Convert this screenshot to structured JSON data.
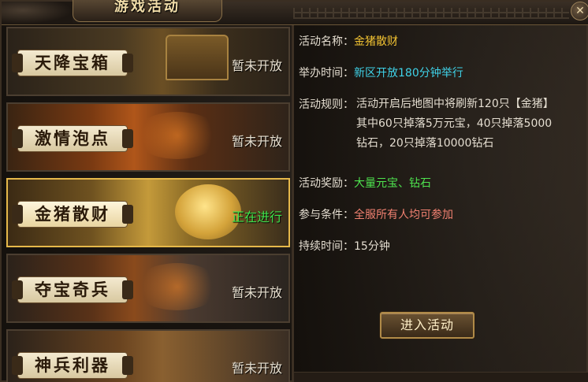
{
  "window": {
    "title": "游戏活动",
    "close_icon": "close-icon"
  },
  "activities": [
    {
      "name": "天降宝箱",
      "status": "暂未开放",
      "active": false
    },
    {
      "name": "激情泡点",
      "status": "暂未开放",
      "active": false
    },
    {
      "name": "金猪散财",
      "status": "正在进行",
      "active": true
    },
    {
      "name": "夺宝奇兵",
      "status": "暂未开放",
      "active": false
    },
    {
      "name": "神兵利器",
      "status": "暂未开放",
      "active": false
    }
  ],
  "detail": {
    "name_label": "活动名称：",
    "name_value": "金猪散财",
    "time_label": "举办时间：",
    "time_value": "新区开放180分钟举行",
    "rule_label": "活动规则：",
    "rule_lines": [
      "活动开启后地图中将刷新120只【金猪】",
      "其中60只掉落5万元宝，40只掉落5000",
      "钻石，20只掉落10000钻石"
    ],
    "reward_label": "活动奖励：",
    "reward_value": "大量元宝、钻石",
    "condition_label": "参与条件：",
    "condition_value": "全服所有人均可参加",
    "duration_label": "持续时间：",
    "duration_value": "15分钟"
  },
  "enter_button": "进入活动",
  "colors": {
    "gold": "#f1c232",
    "cyan": "#3fd2e8",
    "green": "#4ee34e",
    "red": "#f08070",
    "active_border": "#e6b84a",
    "live_status": "#3ee14a"
  }
}
